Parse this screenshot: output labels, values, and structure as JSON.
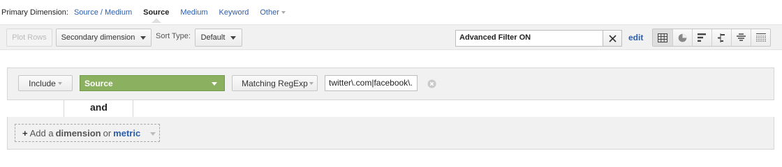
{
  "primary_dimension": {
    "label": "Primary Dimension:",
    "options": [
      "Source / Medium",
      "Source",
      "Medium",
      "Keyword",
      "Other"
    ],
    "active": "Source"
  },
  "toolbar": {
    "plot_rows_label": "Plot Rows",
    "secondary_dimension_label": "Secondary dimension",
    "sort_type_label": "Sort Type:",
    "sort_type_value": "Default",
    "filter_text": "Advanced Filter ON",
    "edit_label": "edit",
    "view_icons": [
      "table-view-icon",
      "pie-view-icon",
      "performance-view-icon",
      "comparison-view-icon",
      "term-cloud-view-icon",
      "pivot-view-icon"
    ]
  },
  "filter": {
    "include_label": "Include",
    "dimension_value": "Source",
    "match_type_label": "Matching RegExp",
    "expression_value": "twitter\\.com|facebook\\.",
    "and_label": "and",
    "add_plus": "+",
    "add_prefix": "Add a",
    "add_dimension": "dimension",
    "add_or": "or",
    "add_metric": "metric",
    "source_color": "#8ab060"
  }
}
